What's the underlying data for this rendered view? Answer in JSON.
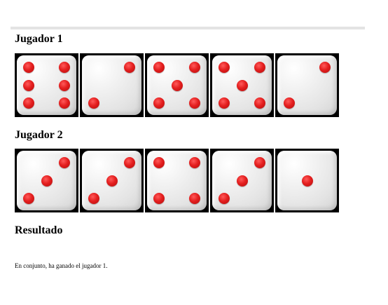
{
  "player1": {
    "heading": "Jugador 1",
    "dice": [
      6,
      2,
      5,
      5,
      2
    ]
  },
  "player2": {
    "heading": "Jugador 2",
    "dice": [
      3,
      3,
      4,
      3,
      1
    ]
  },
  "result": {
    "heading": "Resultado",
    "text": "En conjunto, ha ganado el jugador 1."
  },
  "colors": {
    "pip": "#e41f1f",
    "die_border": "#000000",
    "rule": "#e3e3e3"
  }
}
